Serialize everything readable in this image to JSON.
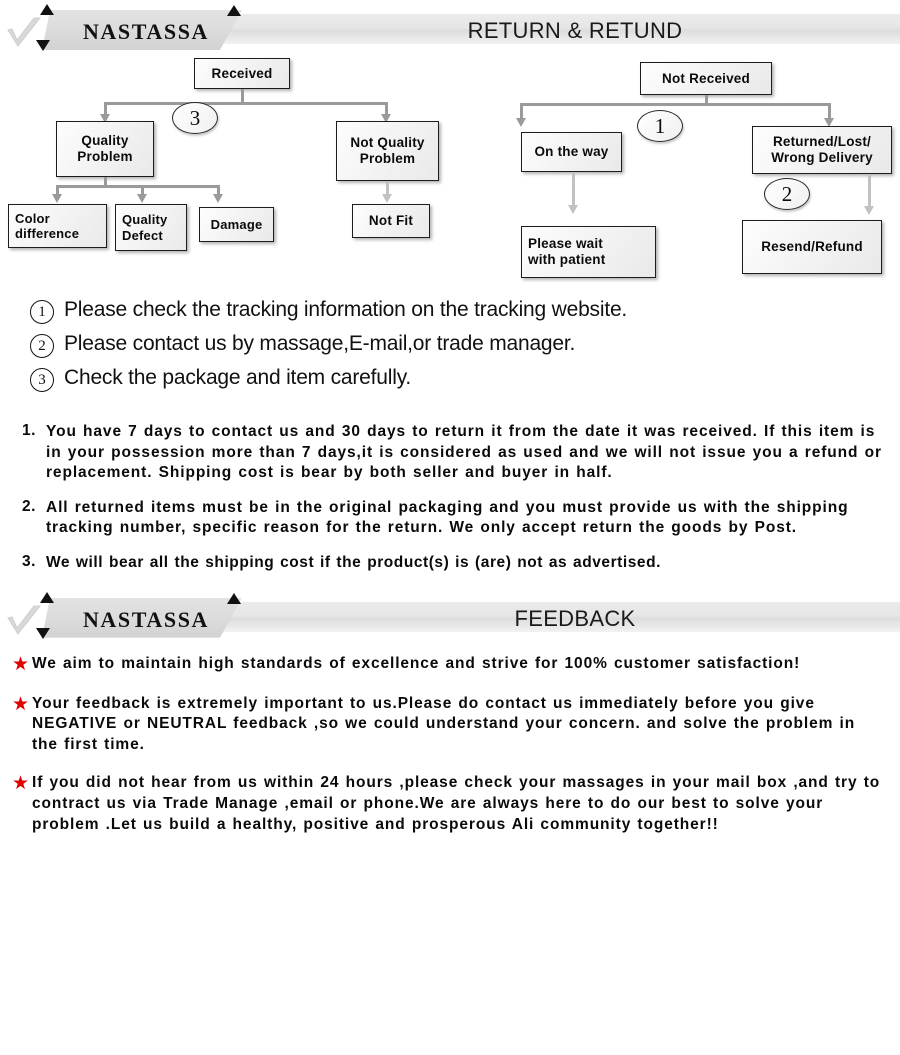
{
  "sections": {
    "return": {
      "brand": "NASTASSA",
      "title": "RETURN & RETUND"
    },
    "feedback": {
      "brand": "NASTASSA",
      "title": "FEEDBACK"
    }
  },
  "flowchart": {
    "left": {
      "root": "Received",
      "marker": "3",
      "branch_quality": "Quality\nProblem",
      "branch_not_quality": "Not Quality\nProblem",
      "leaf_color": "Color\ndifference",
      "leaf_defect": "Quality\nDefect",
      "leaf_damage": "Damage",
      "leaf_not_fit": "Not Fit"
    },
    "right": {
      "root": "Not  Received",
      "marker_1": "1",
      "marker_2": "2",
      "branch_on_the_way": "On the way",
      "branch_returned": "Returned/Lost/\nWrong Delivery",
      "leaf_wait": "Please wait\nwith patient",
      "leaf_resend": "Resend/Refund"
    }
  },
  "notes": [
    {
      "num": "1",
      "text": "Please check the tracking information on the tracking website."
    },
    {
      "num": "2",
      "text": "Please contact us by  massage,E-mail,or trade manager."
    },
    {
      "num": "3",
      "text": "Check the package and item carefully."
    }
  ],
  "policy": [
    {
      "num": "1.",
      "text": "You have 7 days to contact us and 30 days to return it from the date it was received. If this item is in your possession more than 7 days,it is considered as used and we will not issue you a refund or replacement. Shipping cost is bear by both seller and buyer in half."
    },
    {
      "num": "2.",
      "text": "All returned items must be in the original packaging and you must provide us with the shipping tracking number, specific reason for the return. We only accept return the goods by Post."
    },
    {
      "num": "3.",
      "text": "We will bear all the shipping cost if the product(s) is (are) not as advertised."
    }
  ],
  "feedback_items": [
    {
      "bullet": "★",
      "text": "We aim to maintain high standards of excellence and strive  for 100% customer satisfaction!"
    },
    {
      "bullet": "★",
      "text": "Your feedback is extremely important to us.Please do contact us immediately before you give NEGATIVE or NEUTRAL feedback ,so  we could understand your concern. and solve the problem in the first time."
    },
    {
      "bullet": "★",
      "text": "If you did not hear from us within 24 hours ,please check your massages in your mail box ,and try to contract us via Trade Manage ,email or phone.We are always here to do our best to solve your problem .Let us build a healthy, positive and prosperous Ali community together!!"
    }
  ],
  "colors": {
    "star": "#e00000",
    "connector": "#9a9a9a",
    "banner": "#e2e2e2"
  }
}
